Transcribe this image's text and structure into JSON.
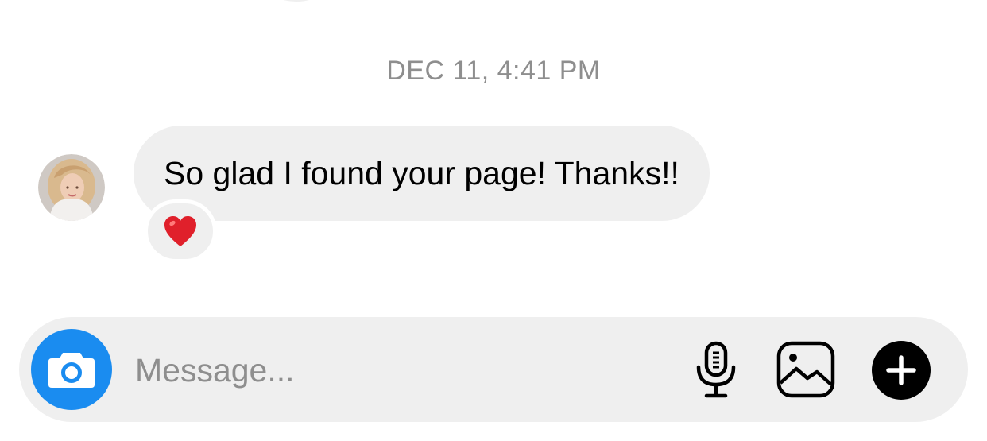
{
  "thread": {
    "timestamp": "DEC 11, 4:41 PM",
    "messages": [
      {
        "text": "So glad I found your page! Thanks!!",
        "reaction": "❤️"
      }
    ]
  },
  "composer": {
    "placeholder": "Message...",
    "icons": {
      "camera": "camera-icon",
      "microphone": "microphone-icon",
      "gallery": "gallery-icon",
      "more": "plus-icon"
    }
  },
  "colors": {
    "accent": "#1a8cf0",
    "bubble": "#efefef",
    "timestamp": "#8e8e8e",
    "heart": "#e0202b"
  }
}
